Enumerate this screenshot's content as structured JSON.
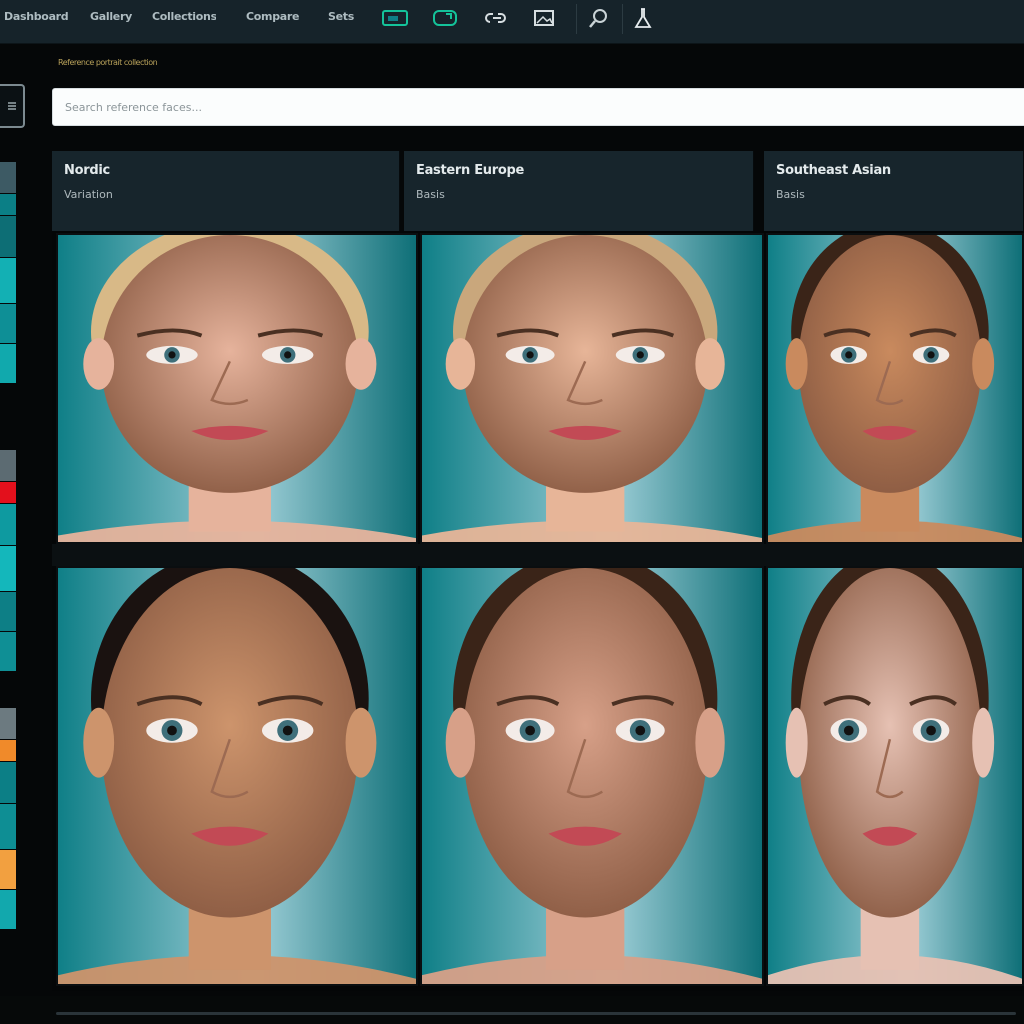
{
  "toolbar": {
    "menu": [
      "Dashboard",
      "Gallery",
      "Collections",
      "Compare",
      "Sets"
    ],
    "tools": [
      {
        "icon": "layout-icon",
        "label": "Layout"
      },
      {
        "icon": "crop-icon",
        "label": "Crop"
      },
      {
        "icon": "link-icon",
        "label": "Link"
      },
      {
        "icon": "image-icon",
        "label": "Image"
      },
      {
        "icon": "search-icon",
        "label": "Search"
      },
      {
        "icon": "flask-icon",
        "label": "Lab"
      }
    ]
  },
  "section_label": "Reference portrait collection",
  "search": {
    "placeholder": "Search reference faces..."
  },
  "columns": [
    {
      "title": "Nordic",
      "subtitle": "Variation"
    },
    {
      "title": "Eastern Europe",
      "subtitle": "Basis"
    },
    {
      "title": "Southeast Asian",
      "subtitle": "Basis"
    }
  ],
  "portraits": [
    {
      "hair": "blonde-short",
      "skin": "#e6b39c"
    },
    {
      "hair": "blonde-ponytail",
      "skin": "#e7b598"
    },
    {
      "hair": "dark-brown",
      "skin": "#c98a5e"
    },
    {
      "hair": "black",
      "skin": "#cd946c"
    },
    {
      "hair": "dark-brown",
      "skin": "#d7a088"
    },
    {
      "hair": "dark-brown",
      "skin": "#e6c1b3"
    }
  ],
  "colors": {
    "accent": "#0f7f87",
    "toolbar": "#16232a",
    "highlight_green": "#14c39a",
    "alert_red": "#e3101c",
    "warning_orange": "#f08a2a"
  },
  "swatches": [
    [
      "#3d5a64",
      "#0b7f86",
      "#0d6e75",
      "#13b0b4",
      "#0e8f96",
      "#11a9ad"
    ],
    [
      "#5c6b72",
      "#e3101c",
      "#0e9aa0",
      "#14b7bb",
      "#0d7f86",
      "#0f8f95"
    ],
    [
      "#6c7a80",
      "#f08a2a",
      "#0c7f86",
      "#0e8e94",
      "#f2a040",
      "#12a8ad"
    ]
  ]
}
